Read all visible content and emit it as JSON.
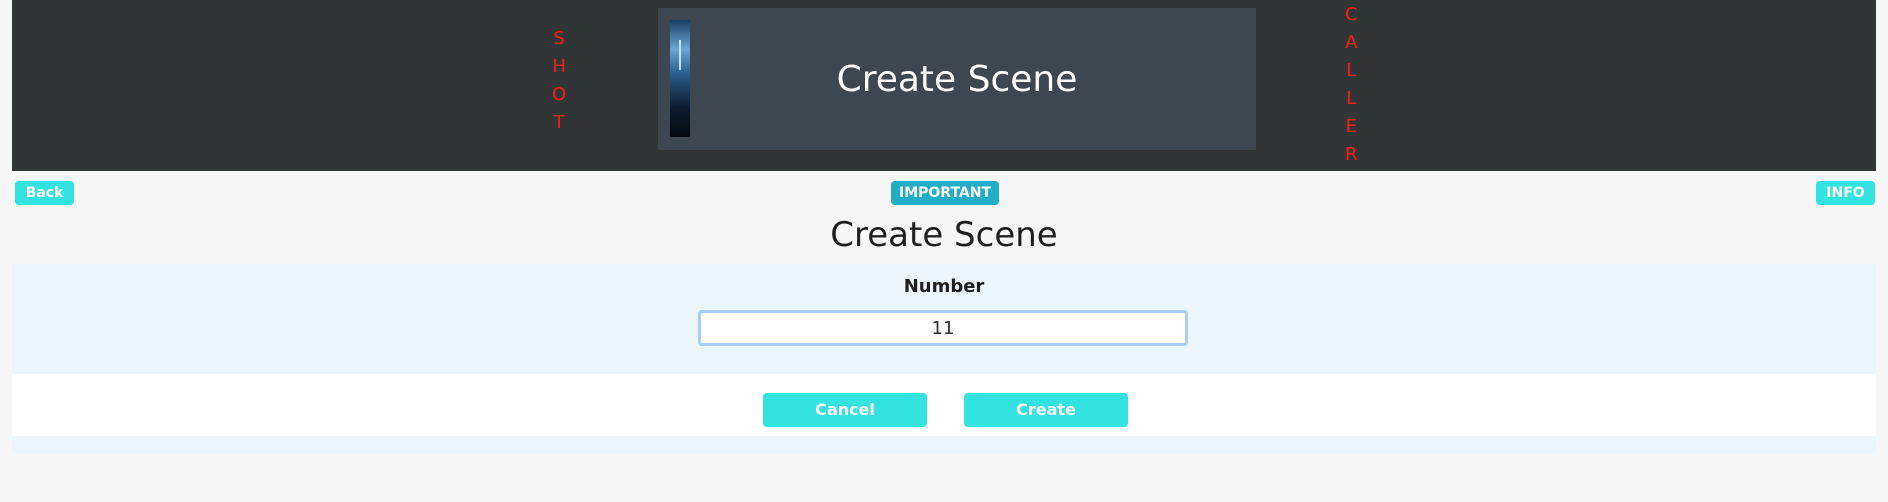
{
  "header": {
    "left_vertical_text": [
      "S",
      "H",
      "O",
      "T"
    ],
    "right_vertical_text": [
      "C",
      "A",
      "L",
      "L",
      "E",
      "R"
    ],
    "hero_title": "Create Scene"
  },
  "nav": {
    "back_label": "Back",
    "important_label": "IMPORTANT",
    "info_label": "INFO"
  },
  "page": {
    "title": "Create Scene"
  },
  "form": {
    "number_label": "Number",
    "number_value": "11"
  },
  "actions": {
    "cancel_label": "Cancel",
    "create_label": "Create"
  },
  "colors": {
    "header_bg": "#333637",
    "accent": "#33e3df",
    "badge": "#21aec6",
    "vertical_text": "#ff1a1a"
  }
}
